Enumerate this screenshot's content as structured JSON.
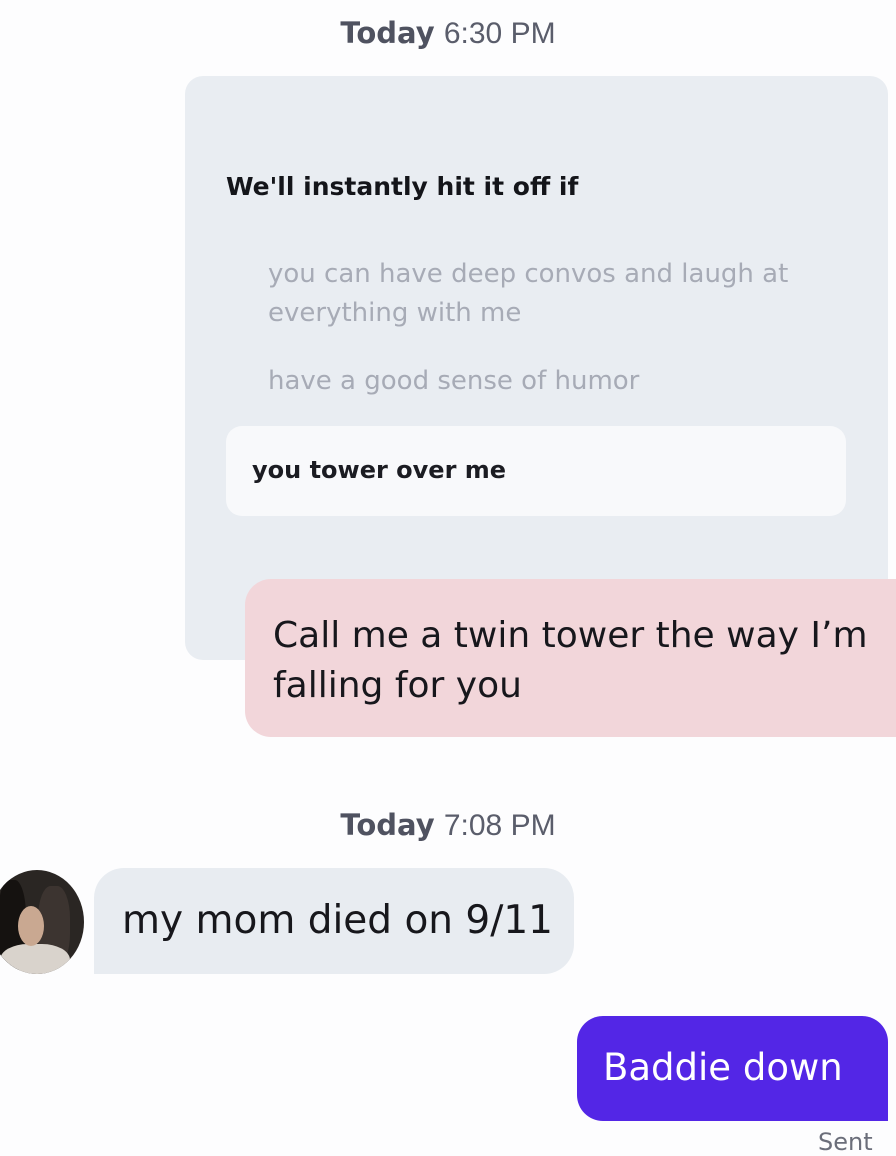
{
  "thread": {
    "timestamp_1": {
      "day": "Today",
      "time": "6:30 PM"
    },
    "prompt": {
      "title": "We'll instantly hit it off if",
      "options": [
        "you can have deep convos and laugh at everything with me",
        "have a good sense of humor"
      ],
      "selected_option": "you tower over me"
    },
    "reply_to_prompt": "Call me a twin tower the way I’m falling for you",
    "timestamp_2": {
      "day": "Today",
      "time": "7:08 PM"
    },
    "incoming_message": "my mom died on 9/11",
    "outgoing_message": "Baddie down",
    "status": "Sent"
  },
  "colors": {
    "prompt_card": "#e9edf2",
    "reply_bubble": "#f2d6da",
    "incoming_bubble": "#e8ecf1",
    "outgoing_bubble": "#5326e6"
  }
}
